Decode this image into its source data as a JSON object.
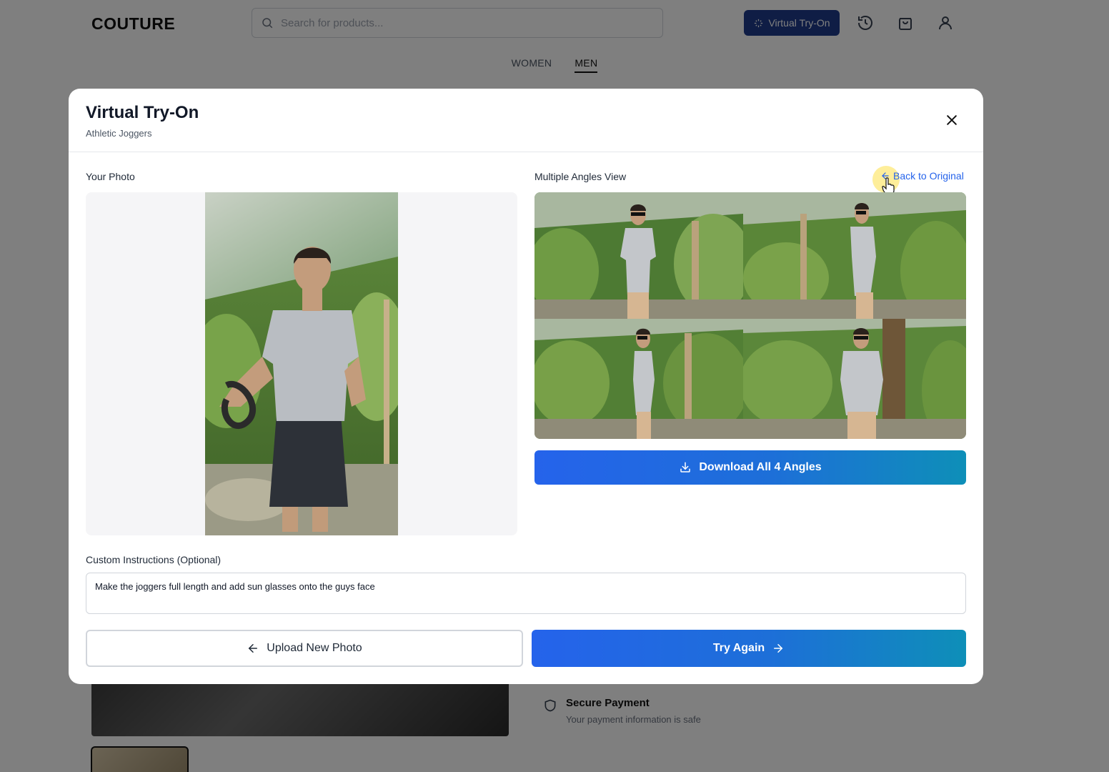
{
  "header": {
    "logo": "COUTURE",
    "search_placeholder": "Search for products...",
    "virtual_tryon_label": "Virtual Try-On",
    "icons": [
      "history-icon",
      "shopping-bag-icon",
      "user-icon"
    ]
  },
  "nav": {
    "items": [
      "WOMEN",
      "MEN"
    ],
    "active": "MEN"
  },
  "background": {
    "secure_title": "Secure Payment",
    "secure_sub": "Your payment information is safe"
  },
  "modal": {
    "title": "Virtual Try-On",
    "subtitle": "Athletic Joggers",
    "your_photo_label": "Your Photo",
    "angles_label": "Multiple Angles View",
    "back_label": "Back to Original",
    "download_label": "Download All 4 Angles",
    "instructions_label": "Custom Instructions (Optional)",
    "instructions_value": "Make the joggers full length and add sun glasses onto the guys face",
    "upload_label": "Upload New Photo",
    "try_again_label": "Try Again"
  },
  "colors": {
    "accent": "#2563eb",
    "gradient_end": "#0e8fb8",
    "nav_button": "#1e3a8a"
  }
}
